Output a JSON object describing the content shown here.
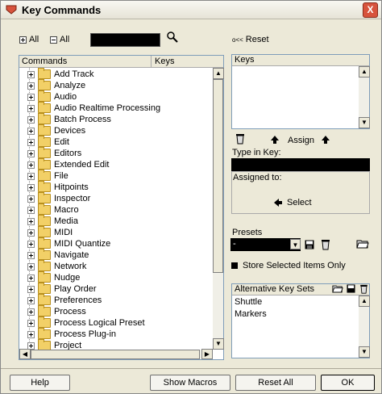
{
  "window": {
    "title": "Key Commands",
    "close_label": "X"
  },
  "toolbar": {
    "expand_all": "All",
    "collapse_all": "All",
    "reset_label": "Reset"
  },
  "commands_panel": {
    "col_commands": "Commands",
    "col_keys": "Keys",
    "items": [
      "Add Track",
      "Analyze",
      "Audio",
      "Audio Realtime Processing",
      "Batch Process",
      "Devices",
      "Edit",
      "Editors",
      "Extended Edit",
      "File",
      "Hitpoints",
      "Inspector",
      "Macro",
      "Media",
      "MIDI",
      "MIDI Quantize",
      "Navigate",
      "Network",
      "Nudge",
      "Play Order",
      "Preferences",
      "Process",
      "Process Logical Preset",
      "Process Plug-in",
      "Project"
    ]
  },
  "keys_panel": {
    "header": "Keys"
  },
  "assign": {
    "label": "Assign",
    "type_in_key": "Type in Key:",
    "assigned_to": "Assigned to:",
    "select": "Select"
  },
  "presets": {
    "label": "Presets",
    "value": "-",
    "store_selected": "Store Selected Items Only"
  },
  "alt_sets": {
    "header": "Alternative Key Sets",
    "items": [
      "Shuttle",
      "Markers"
    ]
  },
  "buttons": {
    "help": "Help",
    "show_macros": "Show Macros",
    "reset_all": "Reset All",
    "ok": "OK"
  },
  "colors": {
    "title_close": "#d7533d",
    "panel_border": "#7f9db9",
    "dialog_bg": "#ece9d8"
  }
}
